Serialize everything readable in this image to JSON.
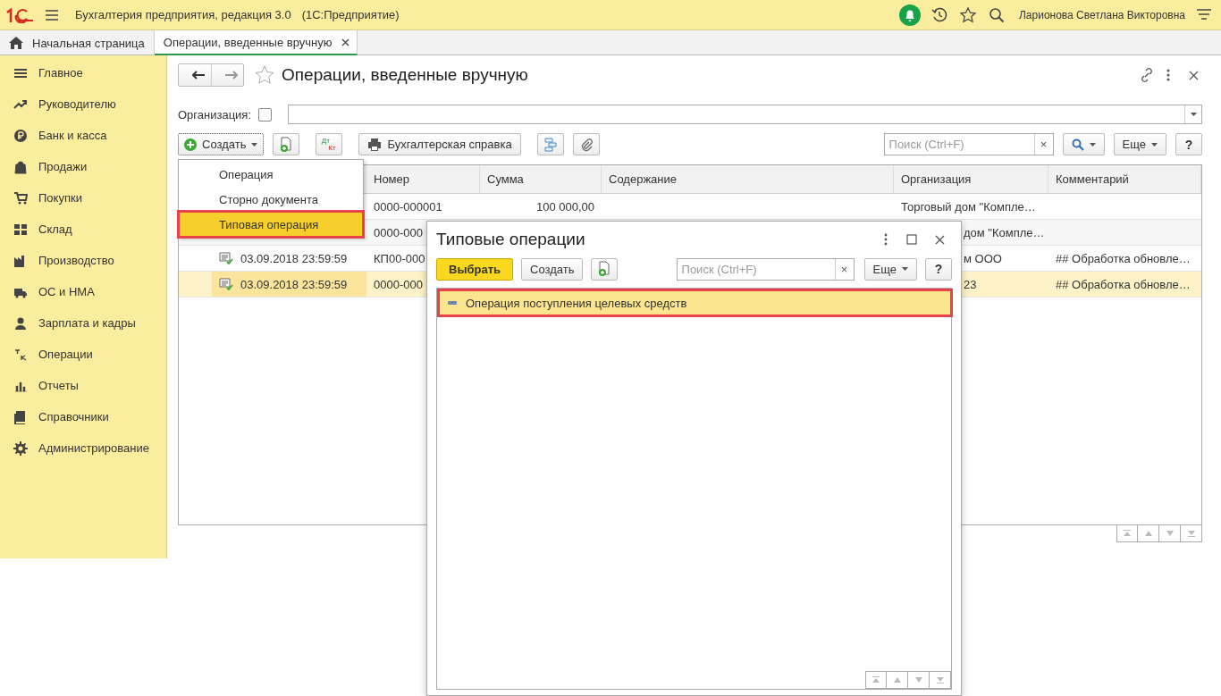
{
  "top_bar": {
    "app_title": "Бухгалтерия предприятия, редакция 3.0",
    "app_platform": "(1С:Предприятие)",
    "user_name": "Ларионова Светлана Викторовна"
  },
  "tabs": [
    {
      "label": "Начальная страница",
      "selected": false,
      "kind": "home"
    },
    {
      "label": "Операции, введенные вручную",
      "selected": true,
      "kind": "document"
    }
  ],
  "sidebar": {
    "items": [
      {
        "label": "Главное"
      },
      {
        "label": "Руководителю"
      },
      {
        "label": "Банк и касса"
      },
      {
        "label": "Продажи"
      },
      {
        "label": "Покупки"
      },
      {
        "label": "Склад"
      },
      {
        "label": "Производство"
      },
      {
        "label": "ОС и НМА"
      },
      {
        "label": "Зарплата и кадры"
      },
      {
        "label": "Операции"
      },
      {
        "label": "Отчеты"
      },
      {
        "label": "Справочники"
      },
      {
        "label": "Администрирование"
      }
    ]
  },
  "form": {
    "title": "Операции, введенные вручную",
    "organization_label": "Организация:",
    "organization_checked": false,
    "toolbar": {
      "create": "Создать",
      "dt": "Дт",
      "kt": "Кт",
      "report": "Бухгалтерская справка",
      "search_placeholder": "Поиск (Ctrl+F)",
      "clear": "×",
      "more": "Еще",
      "help": "?"
    },
    "table": {
      "columns": [
        "Номер",
        "Сумма",
        "Содержание",
        "Организация",
        "Комментарий"
      ],
      "rows": [
        {
          "number": "0000-000001",
          "sum": "100 000,00",
          "org": "Торговый дом \"Компле…",
          "selected": false
        },
        {
          "number": "0000-000",
          "org": "дом \"Компле…",
          "selected": false
        },
        {
          "posted": true,
          "date": "03.09.2018 23:59:59",
          "number": "КП00-000",
          "org": "м ООО",
          "comment": "## Обработка обновле…",
          "selected": false
        },
        {
          "posted": true,
          "date": "03.09.2018 23:59:59",
          "number": "0000-000",
          "org": "23",
          "comment": "## Обработка обновле…",
          "selected": true
        }
      ]
    }
  },
  "create_menu": {
    "items": [
      {
        "label": "Операция",
        "selected": false,
        "outlined": false
      },
      {
        "label": "Сторно документа",
        "selected": false,
        "outlined": false
      },
      {
        "label": "Типовая операция",
        "selected": true,
        "outlined": true
      }
    ]
  },
  "dialog": {
    "title": "Типовые операции",
    "choose": "Выбрать",
    "create": "Создать",
    "search_placeholder": "Поиск (Ctrl+F)",
    "clear": "×",
    "more": "Еще",
    "help": "?",
    "items": [
      {
        "label": "Операция поступления целевых средств",
        "selected": true,
        "outlined": true
      }
    ]
  }
}
